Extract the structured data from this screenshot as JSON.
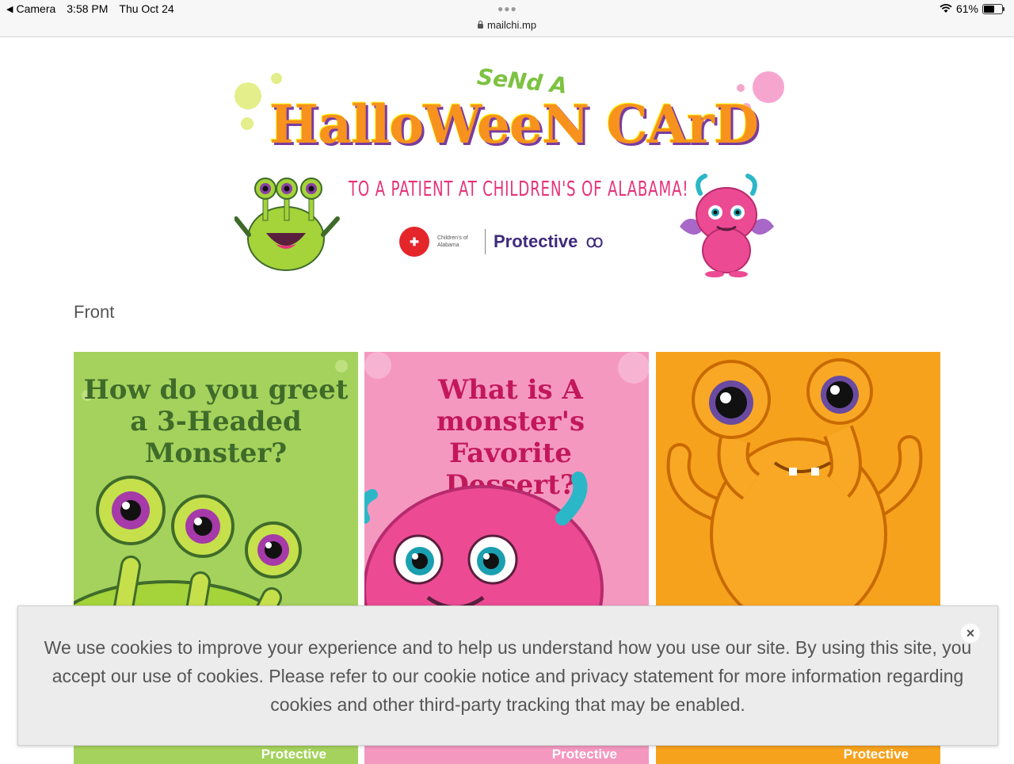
{
  "status_bar": {
    "back_app": "Camera",
    "time": "3:58 PM",
    "date": "Thu Oct 24",
    "battery_percent": "61%",
    "battery_level": 0.61,
    "url": "mailchi.mp"
  },
  "banner": {
    "send_a": "SeNd A",
    "title": "HalloWeeN CArD",
    "subtitle": "TO A PATIENT AT CHILDREN'S OF ALABAMA!",
    "logo_childrens": "Children's of Alabama",
    "logo_protective": "Protective"
  },
  "main": {
    "front_label": "Front",
    "cards": [
      {
        "question": "How do you greet a 3-Headed Monster?",
        "footer": "Protective"
      },
      {
        "question": "What is A monster's Favorite Dessert?",
        "footer": "Protective"
      },
      {
        "question": "",
        "footer": "Protective"
      }
    ]
  },
  "cookie_banner": {
    "text": "We use cookies to improve your experience and to help us understand how you use our site. By using this site, you accept our use of cookies. Please refer to our cookie notice and privacy statement for more information regarding cookies and other third-party tracking that may be enabled.",
    "close_label": "×"
  },
  "colors": {
    "card_green": "#a4d25c",
    "card_pink": "#f598c0",
    "card_orange": "#f7a21d",
    "title_orange": "#f7921e",
    "subtitle_pink": "#e6337a",
    "protective_purple": "#3e2a7c"
  }
}
